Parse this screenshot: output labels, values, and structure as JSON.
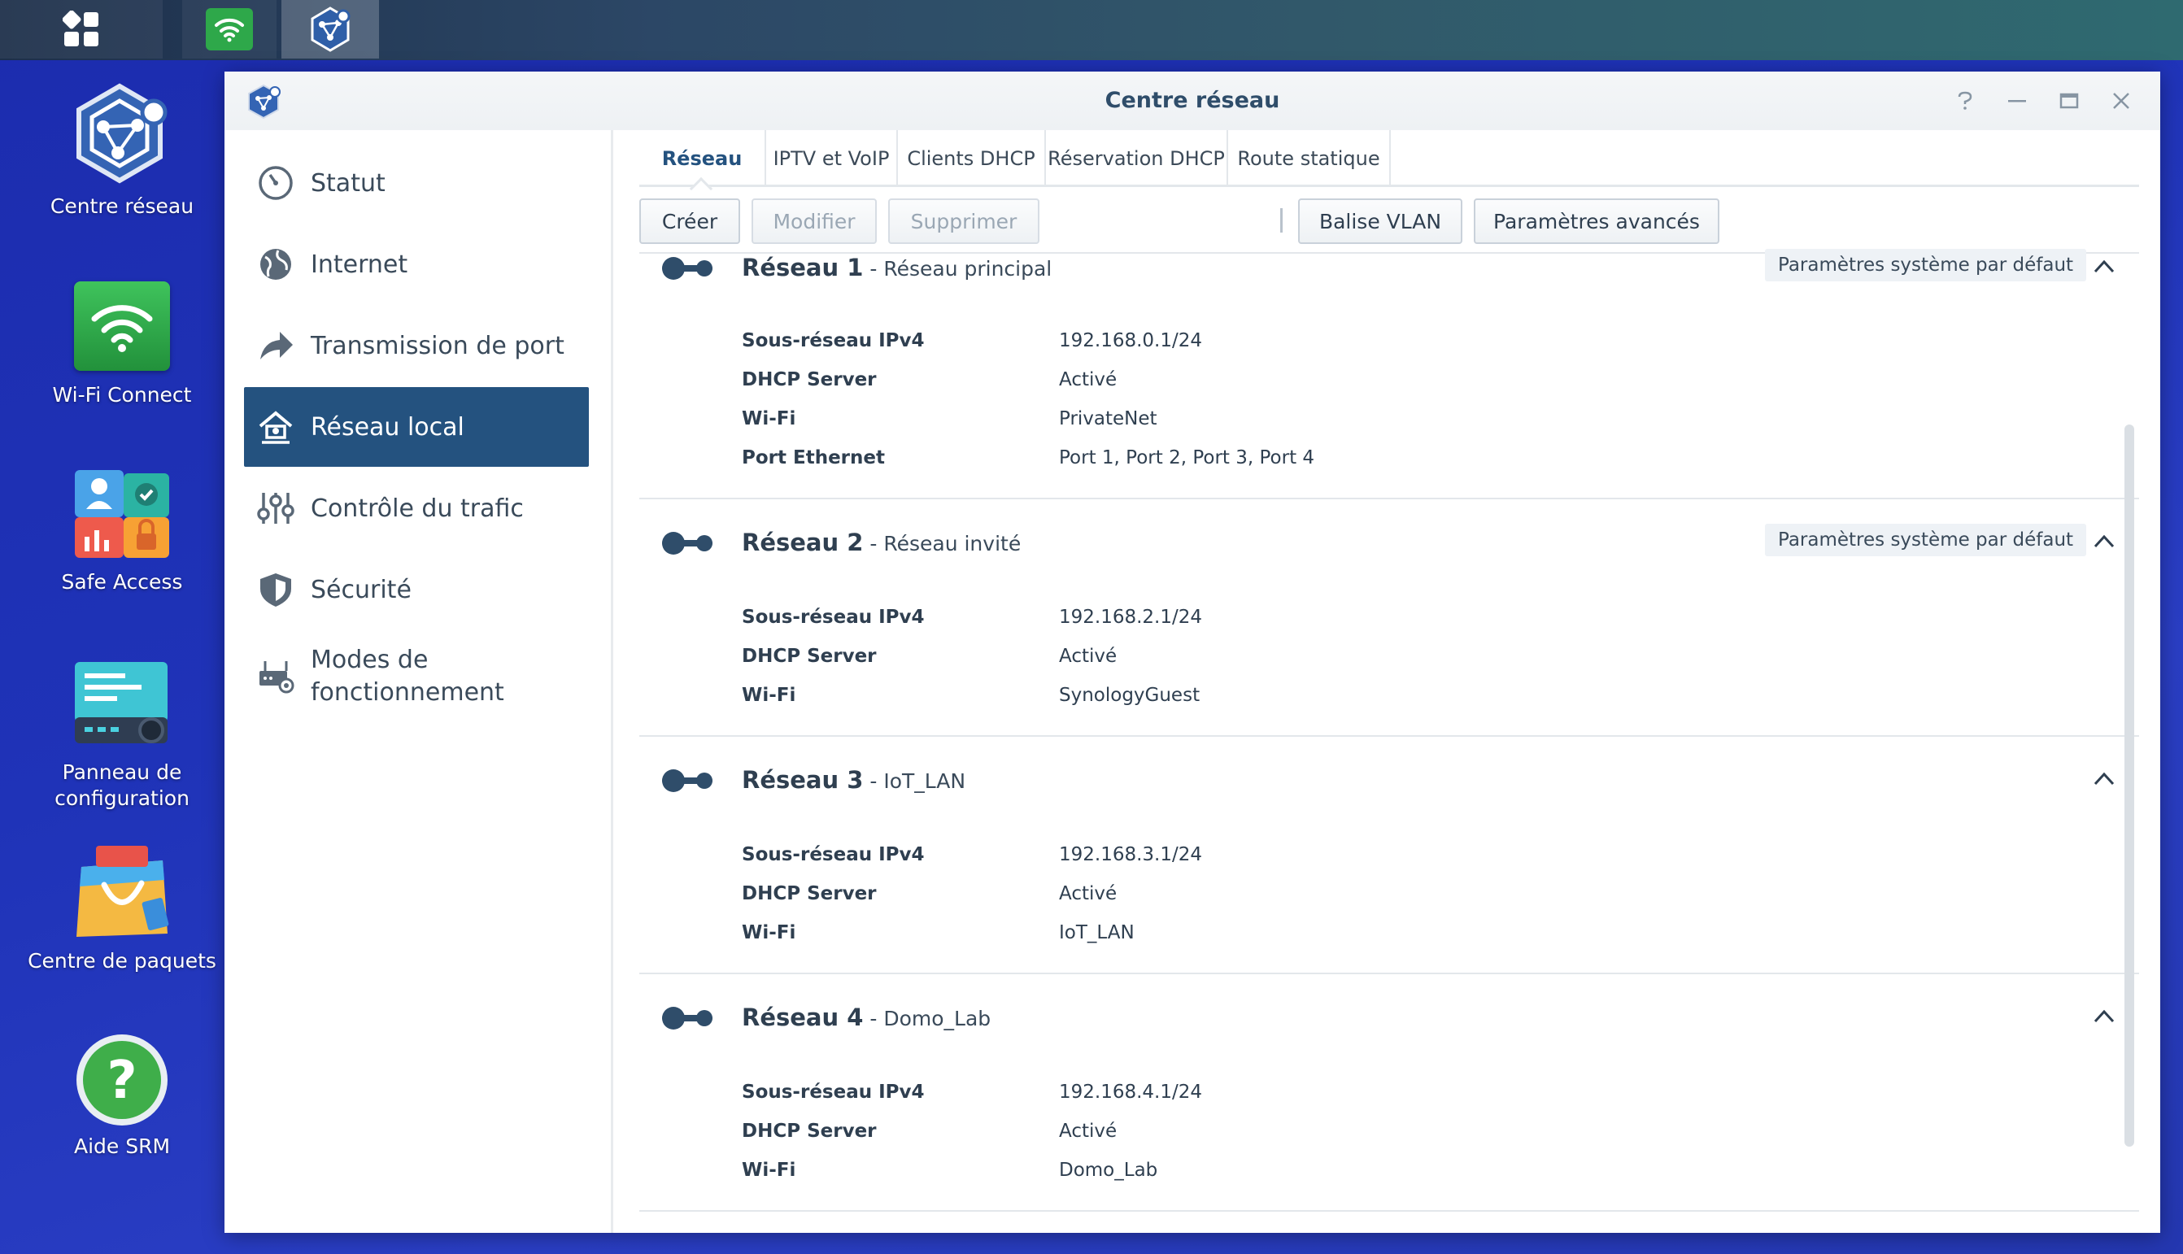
{
  "taskbar": {
    "buttons": [
      {
        "icon": "main-menu-grid-icon"
      },
      {
        "icon": "wifi-connect-icon"
      },
      {
        "icon": "network-center-icon"
      }
    ]
  },
  "desktop": {
    "icons": [
      {
        "label": "Centre réseau",
        "icon": "network-center-icon"
      },
      {
        "label": "Wi-Fi Connect",
        "icon": "wifi-connect-icon"
      },
      {
        "label": "Safe Access",
        "icon": "safe-access-icon"
      },
      {
        "label": "Panneau de configuration",
        "icon": "control-panel-icon"
      },
      {
        "label": "Centre de paquets",
        "icon": "package-center-icon"
      },
      {
        "label": "Aide SRM",
        "icon": "help-icon"
      }
    ]
  },
  "window": {
    "title": "Centre réseau",
    "controls": [
      "help-icon",
      "minimize-icon",
      "maximize-icon",
      "close-icon"
    ]
  },
  "sidebar": {
    "items": [
      {
        "label": "Statut",
        "icon": "status-gauge-icon"
      },
      {
        "label": "Internet",
        "icon": "globe-icon"
      },
      {
        "label": "Transmission de port",
        "icon": "port-forward-arrow-icon"
      },
      {
        "label": "Réseau local",
        "icon": "home-network-icon",
        "active": true
      },
      {
        "label": "Contrôle du trafic",
        "icon": "traffic-sliders-icon"
      },
      {
        "label": "Sécurité",
        "icon": "shield-icon"
      },
      {
        "label": "Modes de fonctionnement",
        "icon": "router-mode-icon"
      }
    ]
  },
  "tabs": [
    {
      "label": "Réseau",
      "active": true
    },
    {
      "label": "IPTV et VoIP"
    },
    {
      "label": "Clients DHCP"
    },
    {
      "label": "Réservation DHCP"
    },
    {
      "label": "Route statique"
    }
  ],
  "toolbar": {
    "create": "Créer",
    "modify": "Modifier",
    "delete": "Supprimer",
    "vlan": "Balise VLAN",
    "advanced": "Paramètres avancés"
  },
  "networks": [
    {
      "name": "Réseau 1",
      "separator": " - ",
      "subtitle": "Réseau principal",
      "badge": "Paramètres système par défaut",
      "rows": [
        {
          "key": "Sous-réseau IPv4",
          "value": "192.168.0.1/24"
        },
        {
          "key": "DHCP Server",
          "value": "Activé"
        },
        {
          "key": "Wi-Fi",
          "value": "PrivateNet"
        },
        {
          "key": "Port Ethernet",
          "value": "Port 1, Port 2, Port 3, Port 4"
        }
      ]
    },
    {
      "name": "Réseau 2",
      "separator": " - ",
      "subtitle": "Réseau invité",
      "badge": "Paramètres système par défaut",
      "rows": [
        {
          "key": "Sous-réseau IPv4",
          "value": "192.168.2.1/24"
        },
        {
          "key": "DHCP Server",
          "value": "Activé"
        },
        {
          "key": "Wi-Fi",
          "value": "SynologyGuest"
        }
      ]
    },
    {
      "name": "Réseau 3",
      "separator": " - ",
      "subtitle": "IoT_LAN",
      "rows": [
        {
          "key": "Sous-réseau IPv4",
          "value": "192.168.3.1/24"
        },
        {
          "key": "DHCP Server",
          "value": "Activé"
        },
        {
          "key": "Wi-Fi",
          "value": "IoT_LAN"
        }
      ]
    },
    {
      "name": "Réseau 4",
      "separator": " - ",
      "subtitle": "Domo_Lab",
      "rows": [
        {
          "key": "Sous-réseau IPv4",
          "value": "192.168.4.1/24"
        },
        {
          "key": "DHCP Server",
          "value": "Activé"
        },
        {
          "key": "Wi-Fi",
          "value": "Domo_Lab"
        }
      ]
    }
  ],
  "colors": {
    "accent": "#24527f",
    "toggle": "#2f4d6a",
    "desktop_bg": "#1f33b8"
  }
}
